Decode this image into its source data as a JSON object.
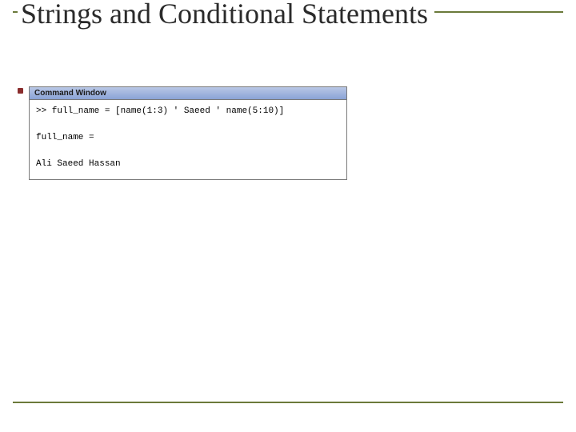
{
  "slide": {
    "title": "Strings and Conditional Statements"
  },
  "commandWindow": {
    "title": "Command Window",
    "lines": {
      "l0": ">> full_name = [name(1:3) ' Saeed ' name(5:10)]",
      "l1": "",
      "l2": "full_name =",
      "l3": "",
      "l4": "Ali Saeed Hassan"
    }
  }
}
